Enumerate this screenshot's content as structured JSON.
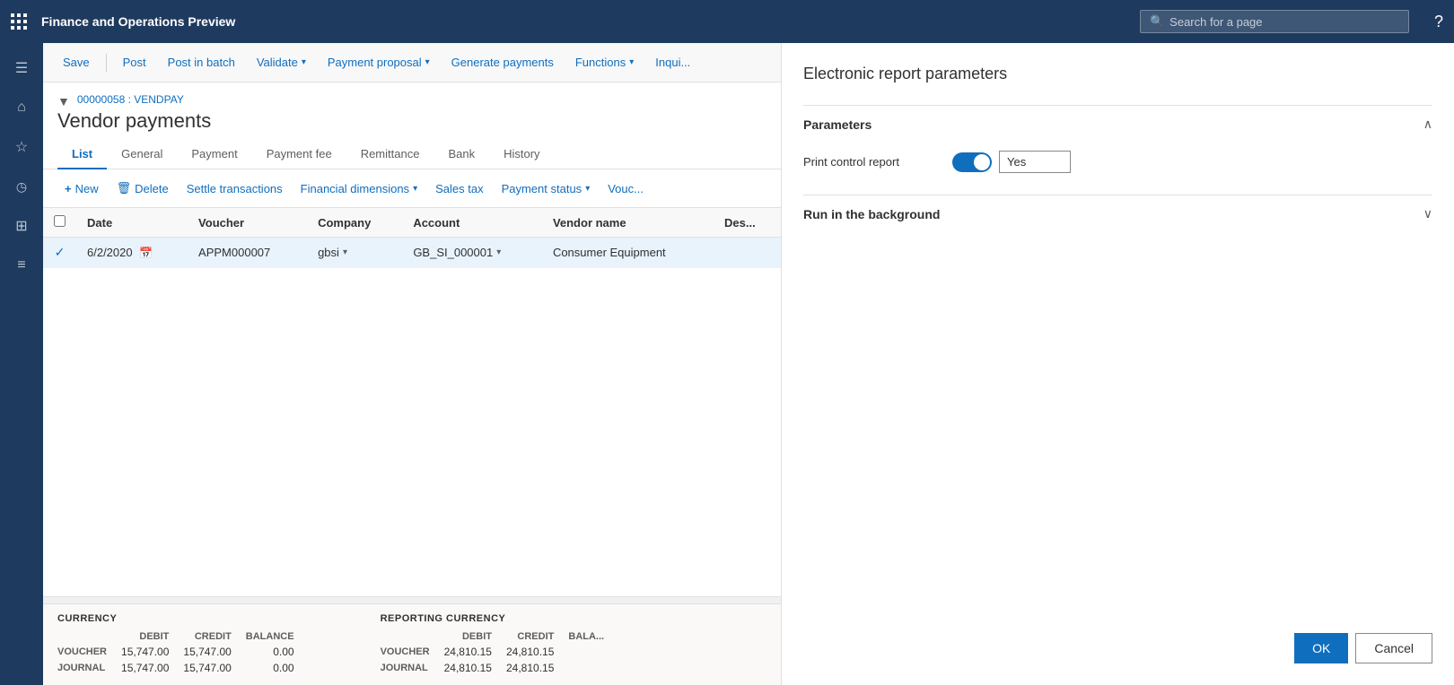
{
  "app": {
    "title": "Finance and Operations Preview",
    "search_placeholder": "Search for a page"
  },
  "toolbar": {
    "save_label": "Save",
    "post_label": "Post",
    "post_batch_label": "Post in batch",
    "validate_label": "Validate",
    "payment_proposal_label": "Payment proposal",
    "generate_payments_label": "Generate payments",
    "functions_label": "Functions",
    "inquire_label": "Inqui..."
  },
  "page": {
    "breadcrumb": "00000058 : VENDPAY",
    "title": "Vendor payments"
  },
  "tabs": [
    {
      "label": "List",
      "active": true
    },
    {
      "label": "General",
      "active": false
    },
    {
      "label": "Payment",
      "active": false
    },
    {
      "label": "Payment fee",
      "active": false
    },
    {
      "label": "Remittance",
      "active": false
    },
    {
      "label": "Bank",
      "active": false
    },
    {
      "label": "History",
      "active": false
    }
  ],
  "action_bar": {
    "new_label": "New",
    "delete_label": "Delete",
    "settle_label": "Settle transactions",
    "financial_dim_label": "Financial dimensions",
    "sales_tax_label": "Sales tax",
    "payment_status_label": "Payment status",
    "vouch_label": "Vouc..."
  },
  "table": {
    "columns": [
      "",
      "Date",
      "Voucher",
      "Company",
      "Account",
      "Vendor name",
      "Des..."
    ],
    "rows": [
      {
        "checked": true,
        "date": "6/2/2020",
        "voucher": "APPM000007",
        "company": "gbsi",
        "account": "GB_SI_000001",
        "vendor_name": "Consumer Equipment",
        "description": ""
      }
    ]
  },
  "summary": {
    "currency_label": "CURRENCY",
    "reporting_currency_label": "REPORTING CURRENCY",
    "debit_label": "DEBIT",
    "credit_label": "CREDIT",
    "balance_label": "BALANCE",
    "rows": [
      {
        "label": "VOUCHER",
        "debit": "15,747.00",
        "credit": "15,747.00",
        "balance": "0.00",
        "report_debit": "24,810.15",
        "report_credit": "24,810.15",
        "report_balance": ""
      },
      {
        "label": "JOURNAL",
        "debit": "15,747.00",
        "credit": "15,747.00",
        "balance": "0.00",
        "report_debit": "24,810.15",
        "report_credit": "24,810.15",
        "report_balance": ""
      }
    ]
  },
  "panel": {
    "title": "Electronic report parameters",
    "parameters_section": {
      "title": "Parameters",
      "expanded": true,
      "fields": [
        {
          "label": "Print control report",
          "toggle_on": true,
          "toggle_value": "Yes"
        }
      ]
    },
    "run_background_section": {
      "title": "Run in the background",
      "expanded": false
    },
    "ok_label": "OK",
    "cancel_label": "Cancel"
  },
  "sidebar": {
    "icons": [
      {
        "name": "hamburger-menu-icon",
        "symbol": "☰"
      },
      {
        "name": "home-icon",
        "symbol": "⌂"
      },
      {
        "name": "star-icon",
        "symbol": "☆"
      },
      {
        "name": "clock-icon",
        "symbol": "🕐"
      },
      {
        "name": "grid-icon",
        "symbol": "⊞"
      },
      {
        "name": "list-icon",
        "symbol": "≡"
      }
    ]
  }
}
